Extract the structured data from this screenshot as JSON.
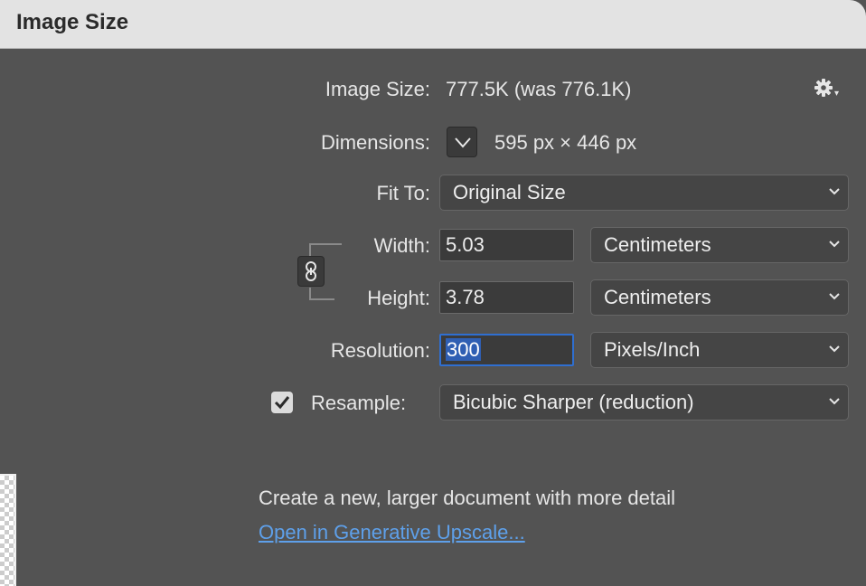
{
  "window": {
    "title": "Image Size"
  },
  "info": {
    "image_size_label": "Image Size:",
    "image_size_value": "777.5K (was 776.1K)",
    "dimensions_label": "Dimensions:",
    "dimensions_value": "595 px  ×  446 px"
  },
  "fit_to": {
    "label": "Fit To:",
    "value": "Original Size"
  },
  "width": {
    "label": "Width:",
    "value": "5.03",
    "unit": "Centimeters"
  },
  "height": {
    "label": "Height:",
    "value": "3.78",
    "unit": "Centimeters"
  },
  "resolution": {
    "label": "Resolution:",
    "value": "300",
    "unit": "Pixels/Inch"
  },
  "resample": {
    "label": "Resample:",
    "checked": true,
    "value": "Bicubic Sharper (reduction)"
  },
  "upscale": {
    "description": "Create a new, larger document with more detail",
    "link": "Open in Generative Upscale..."
  },
  "icons": {
    "settings": "gear-icon",
    "dimensions_toggle": "chevron-down-icon",
    "constrain": "chain-link-icon",
    "select_arrow": "chevron-down-icon",
    "checkbox": "checkmark-icon"
  },
  "colors": {
    "panel_bg": "#535353",
    "titlebar_bg": "#e3e3e3",
    "focus_ring": "#2f6fd1",
    "link": "#5ea0ea"
  }
}
